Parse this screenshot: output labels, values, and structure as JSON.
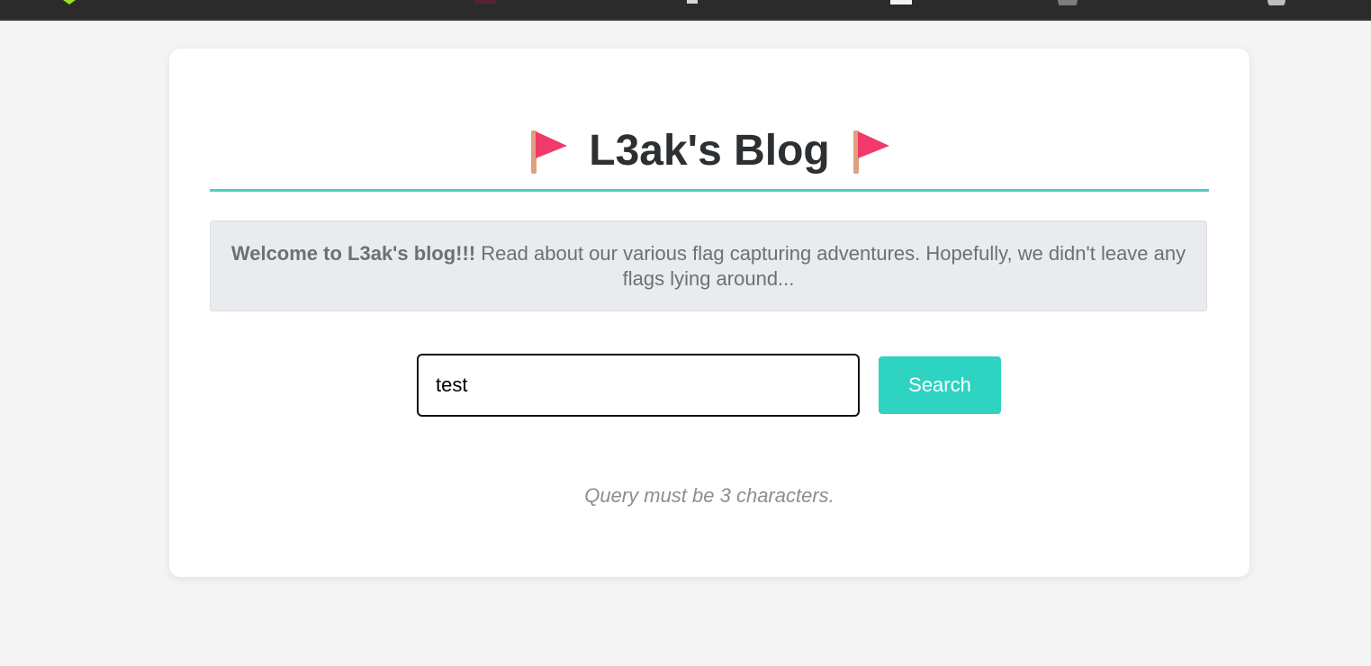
{
  "page": {
    "title_text": "L3ak's Blog",
    "welcome_bold": "Welcome to L3ak's blog!!!",
    "welcome_rest": "Read about our various flag capturing adventures. Hopefully, we didn't leave any flags lying around...",
    "search": {
      "value": "test",
      "button_label": "Search"
    },
    "message": "Query must be 3 characters."
  },
  "colors": {
    "accent": "#4ecdc4",
    "button": "#2ed3c1",
    "flag": "#f03a6a",
    "page_bg": "#f4f4f4",
    "notice_bg": "#e9ebee"
  }
}
